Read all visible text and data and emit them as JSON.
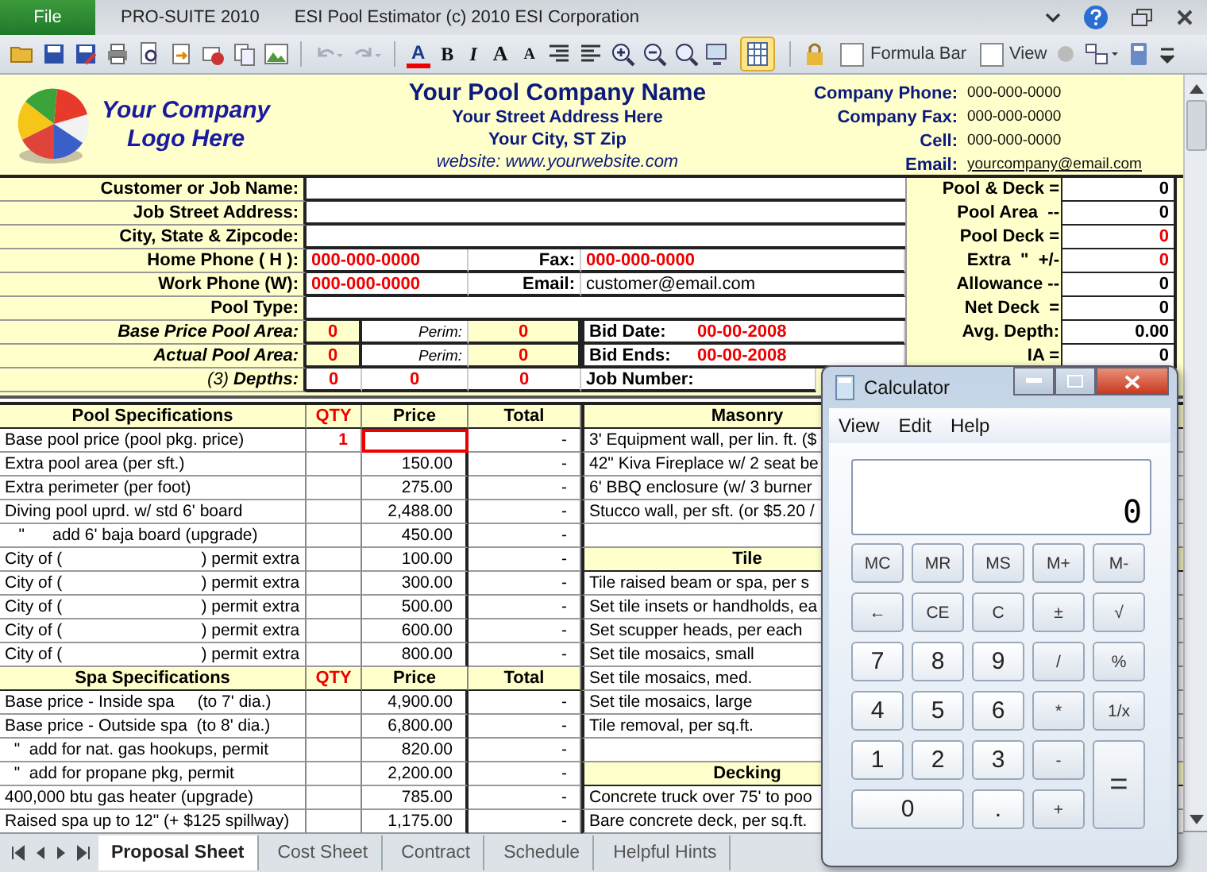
{
  "title_bar": {
    "file_tab": "File",
    "app": "PRO-SUITE 2010",
    "title": "ESI Pool Estimator (c) 2010 ESI Corporation"
  },
  "toolbar": {
    "format_buttons": [
      {
        "kind": "font-color",
        "label": "A"
      },
      {
        "kind": "bold",
        "label": "B"
      },
      {
        "kind": "italic",
        "label": "I"
      },
      {
        "kind": "grow",
        "label": "A"
      },
      {
        "kind": "shrink",
        "label": "A"
      }
    ],
    "gridlines_on": true,
    "toggles": [
      {
        "label": "Formula Bar",
        "checked": false
      },
      {
        "label": "View",
        "checked": false
      }
    ]
  },
  "company": {
    "logo_lines": [
      "Your Company",
      "Logo Here"
    ],
    "name": "Your Pool Company Name",
    "street": "Your Street Address Here",
    "city": "Your City, ST Zip",
    "website": "website: www.yourwebsite.com",
    "contacts": [
      {
        "label": "Company Phone:",
        "value": "000-000-0000",
        "link": false
      },
      {
        "label": "Company Fax:",
        "value": "000-000-0000",
        "link": false
      },
      {
        "label": "Cell:",
        "value": "000-000-0000",
        "link": false
      },
      {
        "label": "Email:",
        "value": "yourcompany@email.com",
        "link": true
      }
    ]
  },
  "job_form": [
    {
      "kind": "blank",
      "label": "Customer or Job Name:"
    },
    {
      "kind": "blank",
      "label": "Job Street Address:"
    },
    {
      "kind": "blank",
      "label": "City, State & Zipcode:"
    },
    {
      "kind": "contact",
      "label": "Home Phone ( H ):",
      "value": "000-000-0000",
      "label2": "Fax:",
      "value2": "000-000-0000",
      "value2_input": true
    },
    {
      "kind": "contact",
      "label": "Work Phone (W):",
      "value": "000-000-0000",
      "label2": "Email:",
      "value2": "customer@email.com",
      "value2_input": false
    },
    {
      "kind": "blank",
      "label": "Pool Type:"
    },
    {
      "kind": "area",
      "label": "Base Price Pool Area:",
      "area": "0",
      "perim_label": "Perim:",
      "perim": "0",
      "bid_label": "Bid Date:",
      "bid_value": "00-00-2008"
    },
    {
      "kind": "area",
      "label": "Actual Pool Area:",
      "area": "0",
      "perim_label": "Perim:",
      "perim": "0",
      "bid_label": "Bid Ends:",
      "bid_value": "00-00-2008"
    },
    {
      "kind": "depths",
      "label": "(3) **Depths:**",
      "depths": [
        "0",
        "0",
        "0"
      ],
      "bid_label": "Job Number:"
    }
  ],
  "summary": [
    {
      "label": "Pool & Deck =",
      "value": "0",
      "input": false
    },
    {
      "label": "Pool Area  --",
      "value": "0",
      "input": false
    },
    {
      "label": "Pool Deck =",
      "value": "0",
      "input": true
    },
    {
      "label": "Extra  \"  +/-",
      "value": "0",
      "input": true
    },
    {
      "label": "Allowance --",
      "value": "0",
      "input": false
    },
    {
      "label": "Net Deck  =",
      "value": "0",
      "input": false
    },
    {
      "label": "Avg. Depth:",
      "value": "0.00",
      "input": false
    },
    {
      "label": "IA =",
      "value": "0",
      "input": false
    }
  ],
  "pool_specifications": {
    "columns": [
      "Pool Specifications",
      "QTY",
      "Price",
      "Total"
    ],
    "rows": [
      {
        "description": "Base pool price (pool pkg. price)",
        "qty": "1",
        "total": "-",
        "selected": true
      },
      {
        "description": "Extra pool area (per sft.)",
        "price": "150.00",
        "total": "-",
        "selected": false
      },
      {
        "description": "Extra perimeter (per foot)",
        "price": "275.00",
        "total": "-",
        "selected": false
      },
      {
        "description": "Diving pool uprd. w/ std 6' board",
        "price": "2,488.00",
        "total": "-",
        "selected": false
      },
      {
        "description": "   \"      add 6' baja board (upgrade)",
        "price": "450.00",
        "total": "-",
        "selected": false
      },
      {
        "description": "City of (                              ) permit extra",
        "price": "100.00",
        "total": "-",
        "selected": false
      },
      {
        "description": "City of (                              ) permit extra",
        "price": "300.00",
        "total": "-",
        "selected": false
      },
      {
        "description": "City of (                              ) permit extra",
        "price": "500.00",
        "total": "-",
        "selected": false
      },
      {
        "description": "City of (                              ) permit extra",
        "price": "600.00",
        "total": "-",
        "selected": false
      },
      {
        "description": "City of (                              ) permit extra",
        "price": "800.00",
        "total": "-",
        "selected": false
      }
    ]
  },
  "spa_specifications": {
    "columns": [
      "Spa Specifications",
      "QTY",
      "Price",
      "Total"
    ],
    "rows": [
      {
        "description": "Base price - Inside spa     (to 7' dia.)",
        "price": "4,900.00",
        "total": "-",
        "selected": false
      },
      {
        "description": "Base price - Outside spa  (to 8' dia.)",
        "price": "6,800.00",
        "total": "-",
        "selected": false
      },
      {
        "description": "  \"  add for nat. gas hookups, permit",
        "price": "820.00",
        "total": "-",
        "selected": false
      },
      {
        "description": "  \"  add for propane pkg, permit",
        "price": "2,200.00",
        "total": "-",
        "selected": false
      },
      {
        "description": "400,000 btu gas heater (upgrade)",
        "price": "785.00",
        "total": "-",
        "selected": false
      },
      {
        "description": "Raised spa up to 12\" (+ $125 spillway)",
        "price": "1,175.00",
        "total": "-",
        "selected": false
      }
    ]
  },
  "side_list": [
    {
      "kind": "heading",
      "text": "Masonry"
    },
    {
      "kind": "item",
      "text": "3' Equipment wall, per lin. ft. ($"
    },
    {
      "kind": "item",
      "text": "42\" Kiva Fireplace w/ 2 seat be"
    },
    {
      "kind": "item",
      "text": "6' BBQ enclosure (w/ 3 burner"
    },
    {
      "kind": "item",
      "text": "Stucco wall, per sft. (or $5.20 /"
    },
    {
      "kind": "blank"
    },
    {
      "kind": "heading",
      "text": "Tile"
    },
    {
      "kind": "item",
      "text": "Tile raised beam or spa, per s"
    },
    {
      "kind": "item",
      "text": "Set tile insets or handholds, ea"
    },
    {
      "kind": "item",
      "text": "Set scupper heads, per each"
    },
    {
      "kind": "item",
      "text": "Set tile mosaics, small"
    },
    {
      "kind": "item",
      "text": "Set tile mosaics, med."
    },
    {
      "kind": "item",
      "text": "Set tile mosaics, large"
    },
    {
      "kind": "item",
      "text": "Tile removal, per sq.ft."
    },
    {
      "kind": "blank"
    },
    {
      "kind": "heading",
      "text": "Decking"
    },
    {
      "kind": "item",
      "text": "Concrete truck over 75' to poo"
    },
    {
      "kind": "item",
      "text": "Bare concrete deck, per sq.ft."
    }
  ],
  "sheet_tabs": [
    {
      "label": "Proposal Sheet",
      "selected": true
    },
    {
      "label": "Cost Sheet",
      "selected": false
    },
    {
      "label": "Contract",
      "selected": false
    },
    {
      "label": "Schedule",
      "selected": false
    },
    {
      "label": "Helpful Hints",
      "selected": false
    }
  ],
  "calculator": {
    "title": "Calculator",
    "menu": [
      "View",
      "Edit",
      "Help"
    ],
    "display": "0",
    "keys": [
      {
        "label": "MC",
        "kind": "memory"
      },
      {
        "label": "MR",
        "kind": "memory"
      },
      {
        "label": "MS",
        "kind": "memory"
      },
      {
        "label": "M+",
        "kind": "memory"
      },
      {
        "label": "M-",
        "kind": "memory"
      },
      {
        "label": "←",
        "kind": "function"
      },
      {
        "label": "CE",
        "kind": "function"
      },
      {
        "label": "C",
        "kind": "function"
      },
      {
        "label": "±",
        "kind": "function"
      },
      {
        "label": "√",
        "kind": "function"
      },
      {
        "label": "7",
        "kind": "digit"
      },
      {
        "label": "8",
        "kind": "digit"
      },
      {
        "label": "9",
        "kind": "digit"
      },
      {
        "label": "/",
        "kind": "function"
      },
      {
        "label": "%",
        "kind": "function"
      },
      {
        "label": "4",
        "kind": "digit"
      },
      {
        "label": "5",
        "kind": "digit"
      },
      {
        "label": "6",
        "kind": "digit"
      },
      {
        "label": "*",
        "kind": "function"
      },
      {
        "label": "1/x",
        "kind": "function"
      },
      {
        "label": "1",
        "kind": "digit"
      },
      {
        "label": "2",
        "kind": "digit"
      },
      {
        "label": "3",
        "kind": "digit"
      },
      {
        "label": "-",
        "kind": "function"
      },
      {
        "label": "=",
        "kind": "tall"
      },
      {
        "label": "0",
        "kind": "wide"
      },
      {
        "label": ".",
        "kind": "digit"
      },
      {
        "label": "+",
        "kind": "function"
      }
    ]
  }
}
